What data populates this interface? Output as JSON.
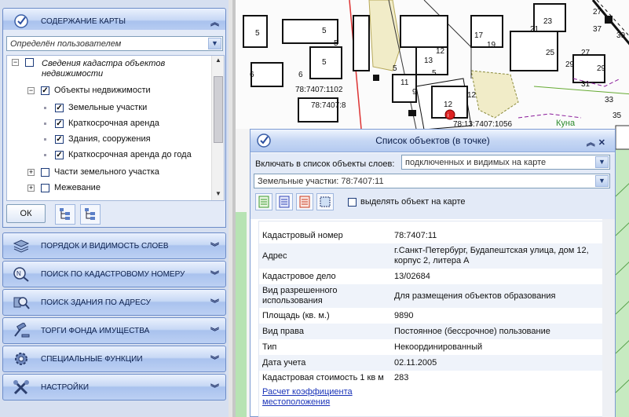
{
  "left_panel": {
    "content_header": "СОДЕРЖАНИЕ КАРТЫ",
    "filter_value": "Определён пользователем",
    "tree": {
      "cadastre": "Сведения кадастра объектов недвижимости",
      "realty": "Объекты недвижимости",
      "items": [
        "Земельные участки",
        "Краткосрочная аренда",
        "Здания, сооружения",
        "Краткосрочная аренда до года"
      ],
      "land_parts": "Части земельного участка",
      "survey": "Межевание"
    },
    "ok_label": "ОК",
    "sections": [
      {
        "label": "ПОРЯДОК И ВИДИМОСТЬ СЛОЕВ",
        "icon": "layers-icon"
      },
      {
        "label": "ПОИСК ПО КАДАСТРОВОМУ НОМЕРУ",
        "icon": "search-number-icon"
      },
      {
        "label": "ПОИСК ЗДАНИЯ ПО АДРЕСУ",
        "icon": "search-building-icon"
      },
      {
        "label": "ТОРГИ ФОНДА ИМУЩЕСТВА",
        "icon": "gavel-icon"
      },
      {
        "label": "СПЕЦИАЛЬНЫЕ ФУНКЦИИ",
        "icon": "gear-icon"
      },
      {
        "label": "НАСТРОЙКИ",
        "icon": "tools-icon"
      }
    ]
  },
  "map": {
    "labels": [
      "78:7407:1102",
      "78:7407:8",
      "78:13:7407:1056",
      "Куна"
    ],
    "numbers": [
      "5",
      "5",
      "5",
      "5",
      "5",
      "5",
      "6",
      "6",
      "9",
      "11",
      "12",
      "12",
      "12",
      "13",
      "17",
      "19",
      "21",
      "23",
      "25",
      "27",
      "27",
      "29",
      "29",
      "31",
      "33",
      "35",
      "37",
      "39"
    ]
  },
  "dialog": {
    "title": "Список объектов (в точке)",
    "include_label": "Включать в список объекты слоев:",
    "include_value": "подключенных и видимых на карте",
    "object_value": "Земельные участки: 78:7407:11",
    "highlight_label": "выделять объект на карте",
    "properties": [
      {
        "key": "Кадастровый номер",
        "value": "78:7407:11"
      },
      {
        "key": "Адрес",
        "value": "г.Санкт-Петербург, Будапештская улица, дом 12, корпус 2, литера А"
      },
      {
        "key": "Кадастровое дело",
        "value": "13/02684"
      },
      {
        "key": "Вид разрешенного использования",
        "value": "Для размещения объектов образования"
      },
      {
        "key": "Площадь (кв. м.)",
        "value": "9890"
      },
      {
        "key": "Вид права",
        "value": "Постоянное (бессрочное) пользование"
      },
      {
        "key": "Тип",
        "value": "Некоординированный"
      },
      {
        "key": "Дата учета",
        "value": "02.11.2005"
      },
      {
        "key": "Кадастровая стоимость 1 кв м",
        "value": "283"
      }
    ],
    "link_text": "Расчет коэффициента местоположения"
  },
  "colors": {
    "accent": "#4a6fb5",
    "header_bg": "#c7d8f5",
    "map_parcel": "#f1ecc8",
    "link": "#1a33b8"
  }
}
